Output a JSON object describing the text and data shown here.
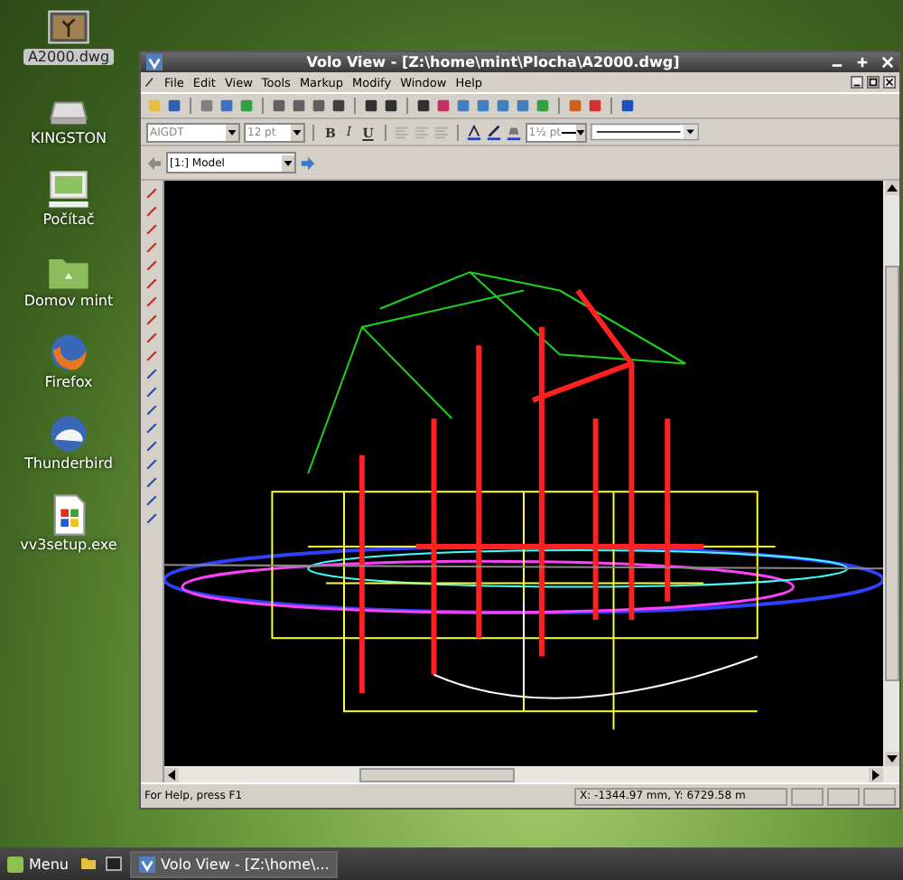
{
  "desktop_icons": [
    {
      "kind": "image",
      "label": "A2000.dwg",
      "selected": true
    },
    {
      "kind": "drive",
      "label": "KINGSTON",
      "selected": false
    },
    {
      "kind": "computer",
      "label": "Počítač",
      "selected": false
    },
    {
      "kind": "folder",
      "label": "Domov mint",
      "selected": false
    },
    {
      "kind": "firefox",
      "label": "Firefox",
      "selected": false
    },
    {
      "kind": "thunderbird",
      "label": "Thunderbird",
      "selected": false
    },
    {
      "kind": "exe",
      "label": "vv3setup.exe",
      "selected": false
    }
  ],
  "window": {
    "title": "Volo View - [Z:\\home\\mint\\Plocha\\A2000.dwg]",
    "menu": [
      "File",
      "Edit",
      "View",
      "Tools",
      "Markup",
      "Modify",
      "Window",
      "Help"
    ],
    "font_select": {
      "value": "AIGDT",
      "disabled": true
    },
    "size_select": {
      "value": "12 pt",
      "disabled": true
    },
    "format_buttons": [
      "B",
      "I",
      "U"
    ],
    "lineweight_select": {
      "value": "1½ pt",
      "disabled": true
    },
    "view_select": {
      "value": "[1:] Model"
    },
    "status_bar": {
      "help": "For Help, press F1",
      "coordinates": "X: -1344.97 mm, Y: 6729.58 m"
    }
  },
  "taskbar": {
    "menu_label": "Menu",
    "tasks": [
      {
        "label": "Volo View - [Z:\\home\\...",
        "selected": true
      }
    ]
  }
}
